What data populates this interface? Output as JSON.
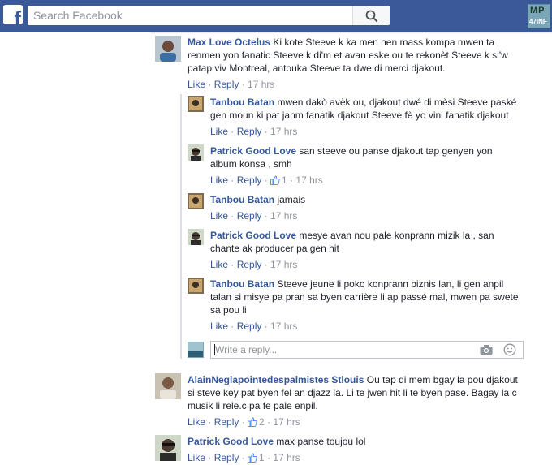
{
  "search": {
    "placeholder": "Search Facebook"
  },
  "brand": {
    "top": "MP",
    "bottom": "47INF"
  },
  "reply_box": {
    "placeholder": "Write a reply..."
  },
  "comments": [
    {
      "author": "Max Love Octelus",
      "text": "Ki kote Steeve k ka men nen mass kompa mwen ta renmen yon fanatic Steeve k di'm et avan eske ou te rekonèt Steeve k si'w patap viv Montreal, antouka Steeve ta dwe di merci djakout.",
      "like": "Like",
      "reply": "Reply",
      "time": "17 hrs",
      "likes": ""
    },
    {
      "author": "Tanbou Batan",
      "text": "mwen dakò avèk ou, djakout dwé di mèsi Steeve paské gen moun ki pat janm fanatik djakout Steeve fè yo vini fanatik djakout",
      "like": "Like",
      "reply": "Reply",
      "time": "17 hrs",
      "likes": ""
    },
    {
      "author": "Patrick Good Love",
      "text": "san steeve ou panse djakout tap genyen yon album konsa , smh",
      "like": "Like",
      "reply": "Reply",
      "time": "17 hrs",
      "likes": "1"
    },
    {
      "author": "Tanbou Batan",
      "text": "jamais",
      "like": "Like",
      "reply": "Reply",
      "time": "17 hrs",
      "likes": ""
    },
    {
      "author": "Patrick Good Love",
      "text": "mesye avan nou pale konprann mizik la , san chante ak producer pa gen hit",
      "like": "Like",
      "reply": "Reply",
      "time": "17 hrs",
      "likes": ""
    },
    {
      "author": "Tanbou Batan",
      "text": "Steeve jeune li poko konprann biznis lan, li gen anpil talan si misye pa pran sa byen carrière li ap passé mal, mwen pa swete sa pou li",
      "like": "Like",
      "reply": "Reply",
      "time": "17 hrs",
      "likes": ""
    },
    {
      "author": "AlainNeglapointedespalmistes Stlouis",
      "text": "Ou tap di mem bgay la pou djakout si steve key pat byen fel an djazz la. Li te jwen hit li te byen pase. Bagay la c musik li rele.c pa fe pale enpil.",
      "like": "Like",
      "reply": "Reply",
      "time": "17 hrs",
      "likes": "2"
    },
    {
      "author": "Patrick Good Love",
      "text": "max panse toujou lol",
      "like": "Like",
      "reply": "Reply",
      "time": "17 hrs",
      "likes": "1"
    }
  ]
}
